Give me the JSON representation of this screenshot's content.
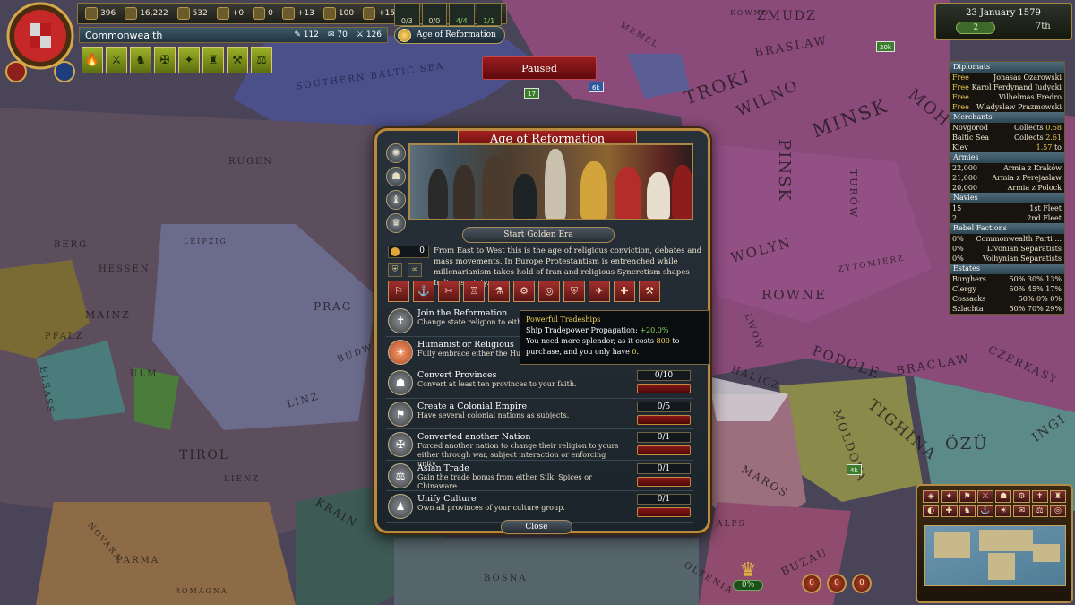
{
  "top": {
    "country": "Commonwealth",
    "resources": [
      {
        "icon": "ducats-icon",
        "value": "396"
      },
      {
        "icon": "manpower-icon",
        "value": "16,222"
      },
      {
        "icon": "sailors-icon",
        "value": "532"
      },
      {
        "icon": "stability-icon",
        "value": "+0"
      },
      {
        "icon": "corruption-icon",
        "value": "0"
      },
      {
        "icon": "prestige-icon",
        "value": "+13"
      },
      {
        "icon": "legitimacy-icon",
        "value": "100"
      },
      {
        "icon": "power-projection-icon",
        "value": "+15"
      }
    ],
    "counters": [
      "0/3",
      "0/0",
      "4/4",
      "1/1"
    ],
    "mana": [
      {
        "icon": "admin-power-icon",
        "value": "112"
      },
      {
        "icon": "diplo-power-icon",
        "value": "70"
      },
      {
        "icon": "military-power-icon",
        "value": "126"
      }
    ],
    "age_button": "Age of Reformation",
    "paused": "Paused",
    "date": "23 January 1579",
    "speed": "2",
    "rank": "7th"
  },
  "map_labels": {
    "zmudz": "ZMUDZ",
    "kowno": "KOWNO",
    "braslaw": "BRASLAW",
    "memel": "MEMEL",
    "southern_baltic": "SOUTHERN BALTIC SEA",
    "troki": "TROKI",
    "wilno": "WILNO",
    "minsk": "MINSK",
    "moh": "MOH",
    "pinsk": "PINSK",
    "turow": "TURÓW",
    "wolyn": "WOLYN",
    "rowne": "ROWNE",
    "zytomierz": "ZYTOMIERZ",
    "podole": "PODOLE",
    "braclaw": "BRACLAW",
    "czerkasy": "CZERKASY",
    "tighina": "TIGHINA",
    "ozu": "ÖZÜ",
    "moldova": "MOLDOVA",
    "ingi": "INGI",
    "lwow": "LWOW",
    "halicz": "HALICZ",
    "maros": "MAROS",
    "buzau": "BUZAU",
    "oltenia": "OLTENIA",
    "bosna": "BOSNA",
    "tirol": "TIROL",
    "krain": "KRAIN",
    "linz": "LINZ",
    "mainz": "MAINZ",
    "hessen": "HESSEN",
    "leipzig": "LEIPZIG",
    "prag": "PRAG",
    "rugen": "RUGEN",
    "pfalz": "PFALZ",
    "ulm": "ULM",
    "elsass": "ELSASS",
    "berg": "BERG",
    "parma": "PARMA",
    "romagna": "ROMAGNA",
    "lienz": "LIENZ",
    "novara": "NOVARA",
    "alps": "ALPS",
    "budweis": "BUDWEIS"
  },
  "map_units": [
    {
      "label": "20k"
    },
    {
      "label": "17"
    },
    {
      "label": "6k"
    },
    {
      "label": "4k"
    }
  ],
  "right_panel": {
    "diplomats_header": "Diplomats",
    "diplomats": [
      {
        "status": "Free",
        "name": "Jonasas Ozarowski"
      },
      {
        "status": "Free",
        "name": "Karol Ferdynand Judycki"
      },
      {
        "status": "Free",
        "name": "Vilhelmas Fredro"
      },
      {
        "status": "Free",
        "name": "Wladyslaw Prazmowski"
      }
    ],
    "merchants_header": "Merchants",
    "merchants": [
      {
        "node": "Novgorod",
        "action": "Collects",
        "value": "0.58"
      },
      {
        "node": "Baltic Sea",
        "action": "Collects",
        "value": "2.61"
      },
      {
        "node": "Kiev",
        "action": "to",
        "value": "1.57"
      }
    ],
    "armies_header": "Armies",
    "armies": [
      {
        "size": "22,000",
        "name": "Armia z Kraków"
      },
      {
        "size": "21,000",
        "name": "Armia z Perejaslaw"
      },
      {
        "size": "20,000",
        "name": "Armia z Polock"
      }
    ],
    "navies_header": "Navies",
    "navies": [
      {
        "size": "15",
        "name": "1st Fleet"
      },
      {
        "size": "2",
        "name": "2nd Fleet"
      }
    ],
    "rebels_header": "Rebel Factions",
    "rebels": [
      {
        "pct": "0%",
        "name": "Commonwealth Parti ..."
      },
      {
        "pct": "0%",
        "name": "Livonian Separatists"
      },
      {
        "pct": "0%",
        "name": "Volhynian Separatists"
      }
    ],
    "estates_header": "Estates",
    "estates": [
      {
        "name": "Burghers",
        "a": "50%",
        "b": "30%",
        "c": "13%"
      },
      {
        "name": "Clergy",
        "a": "50%",
        "b": "45%",
        "c": "17%"
      },
      {
        "name": "Cossacks",
        "a": "50%",
        "b": "0%",
        "c": "0%"
      },
      {
        "name": "Szlachta",
        "a": "50%",
        "b": "70%",
        "c": "29%"
      }
    ]
  },
  "dialog": {
    "title": "Age of Reformation",
    "golden_era_button": "Start Golden Era",
    "splendor": "0",
    "description": "From East to West this is the age of religious conviction, debates and mass movements. In Europe Protestantism is entrenched while millenarianism takes hold of Iran and religious Syncretism shapes Indian society.",
    "objectives": [
      {
        "title": "Join the Reformation",
        "desc": "Change state religion to either P",
        "progress": ""
      },
      {
        "title": "Humanist or Religious",
        "desc": "Fully embrace either the Human",
        "progress": ""
      },
      {
        "title": "Convert Provinces",
        "desc": "Convert at least ten provinces to your faith.",
        "progress": "0/10"
      },
      {
        "title": "Create a Colonial Empire",
        "desc": "Have several colonial nations as subjects.",
        "progress": "0/5"
      },
      {
        "title": "Converted another Nation",
        "desc": "Forced another nation to change their religion to yours either through war, subject interaction or enforcing unity.",
        "progress": "0/1"
      },
      {
        "title": "Asian Trade",
        "desc": "Gain the trade bonus from either Silk, Spices or Chinaware.",
        "progress": "0/1"
      },
      {
        "title": "Unify Culture",
        "desc": "Own all provinces of your culture group.",
        "progress": "0/1"
      }
    ],
    "close": "Close"
  },
  "tooltip": {
    "title": "Powerful Tradeships",
    "effect_label": "Ship Tradepower Propagation:",
    "effect_value": "+20.0%",
    "line1": "You need more splendor, as it costs",
    "cost": "800",
    "line2": "to purchase, and you only have",
    "have": "0",
    "end": "."
  },
  "bottom": {
    "crown_pct": "0%",
    "counters": [
      "0",
      "0",
      "0"
    ]
  },
  "colors": {
    "accent": "#b8893e",
    "title_red": "#a3221f",
    "commonwealth": "#8e4a7e"
  }
}
